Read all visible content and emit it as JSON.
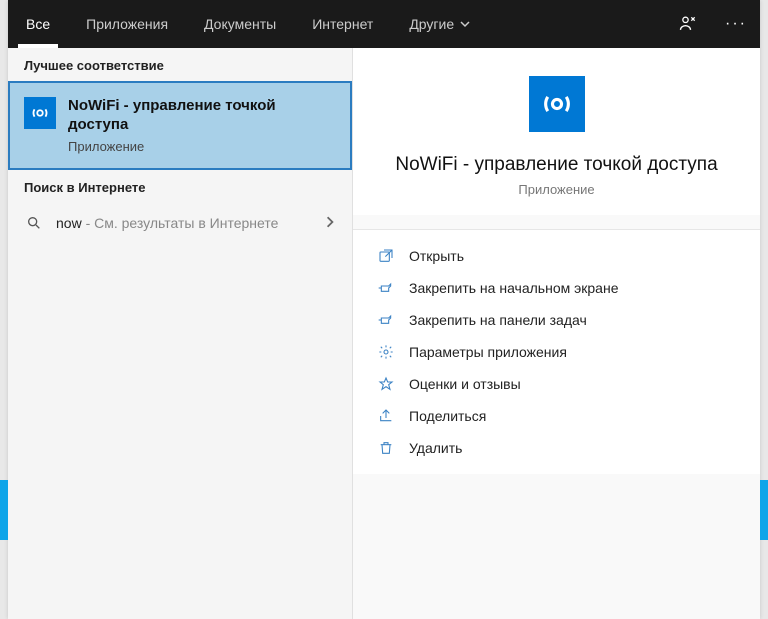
{
  "header": {
    "tabs": [
      {
        "label": "Все",
        "active": true
      },
      {
        "label": "Приложения",
        "active": false
      },
      {
        "label": "Документы",
        "active": false
      },
      {
        "label": "Интернет",
        "active": false
      },
      {
        "label": "Другие",
        "active": false,
        "dropdown": true
      }
    ]
  },
  "left": {
    "best_match_label": "Лучшее соответствие",
    "result": {
      "title": "NoWiFi - управление точкой доступа",
      "subtitle": "Приложение"
    },
    "web_label": "Поиск в Интернете",
    "web_result": {
      "query": "now",
      "suffix": " - См. результаты в Интернете"
    }
  },
  "detail": {
    "title": "NoWiFi - управление точкой доступа",
    "subtitle": "Приложение",
    "actions": [
      {
        "icon": "open",
        "label": "Открыть"
      },
      {
        "icon": "pin",
        "label": "Закрепить на начальном экране"
      },
      {
        "icon": "pin",
        "label": "Закрепить на панели задач"
      },
      {
        "icon": "gear",
        "label": "Параметры приложения"
      },
      {
        "icon": "star",
        "label": "Оценки и отзывы"
      },
      {
        "icon": "share",
        "label": "Поделиться"
      },
      {
        "icon": "trash",
        "label": "Удалить"
      }
    ]
  }
}
